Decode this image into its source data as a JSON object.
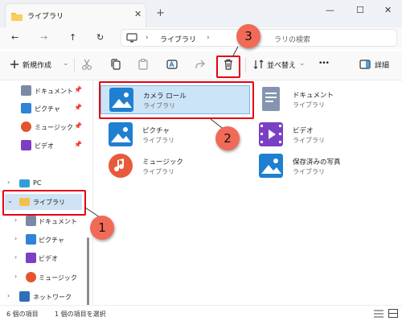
{
  "tab": {
    "title": "ライブラリ",
    "close": "✕",
    "new_tab": "+"
  },
  "window": {
    "minimize": "—",
    "maximize": "☐",
    "close": "✕"
  },
  "nav": {
    "back": "←",
    "forward": "→",
    "up": "↑",
    "refresh": "↻",
    "chevron": "›",
    "address": "ライブラリ",
    "search_placeholder": "ラリの検索"
  },
  "toolbar": {
    "new_label": "新規作成",
    "new_caret": "⌄",
    "sort_label": "並べ替え",
    "sort_caret": "⌄",
    "more": "•••",
    "details_label": "詳細"
  },
  "sidebar": {
    "pinned": [
      {
        "label": "ドキュメント",
        "color": "#7a8aa5"
      },
      {
        "label": "ピクチャ",
        "color": "#2f83d8"
      },
      {
        "label": "ミュージック",
        "color": "#e4542e"
      },
      {
        "label": "ビデオ",
        "color": "#7b3fc4"
      }
    ],
    "pin_glyph": "📌",
    "tree": [
      {
        "label": "PC",
        "expand": "›",
        "color": "#2f9fd8"
      },
      {
        "label": "ライブラリ",
        "expand": "⌄",
        "color": "#f3c14a"
      },
      {
        "label": "ドキュメント",
        "expand": "›",
        "color": "#7a8aa5"
      },
      {
        "label": "ピクチャ",
        "expand": "›",
        "color": "#2f83d8"
      },
      {
        "label": "ビデオ",
        "expand": "›",
        "color": "#7b3fc4"
      },
      {
        "label": "ミュージック",
        "expand": "›",
        "color": "#e4542e"
      },
      {
        "label": "ネットワーク",
        "expand": "›",
        "color": "#2f6fb8"
      }
    ]
  },
  "libraries": [
    {
      "name": "カメラ ロール",
      "sub": "ライブラリ",
      "color": "#1f7fd1",
      "selected": true
    },
    {
      "name": "ドキュメント",
      "sub": "ライブラリ",
      "color": "#8595b0"
    },
    {
      "name": "ピクチャ",
      "sub": "ライブラリ",
      "color": "#1f7fd1"
    },
    {
      "name": "ビデオ",
      "sub": "ライブラリ",
      "color": "#7b3fc4"
    },
    {
      "name": "ミュージック",
      "sub": "ライブラリ",
      "color": "#e85a3a"
    },
    {
      "name": "保存済みの写真",
      "sub": "ライブラリ",
      "color": "#1f7fd1"
    }
  ],
  "annotations": {
    "one": "1",
    "two": "2",
    "three": "3"
  },
  "status": {
    "items": "6 個の項目",
    "selected": "1 個の項目を選択"
  }
}
